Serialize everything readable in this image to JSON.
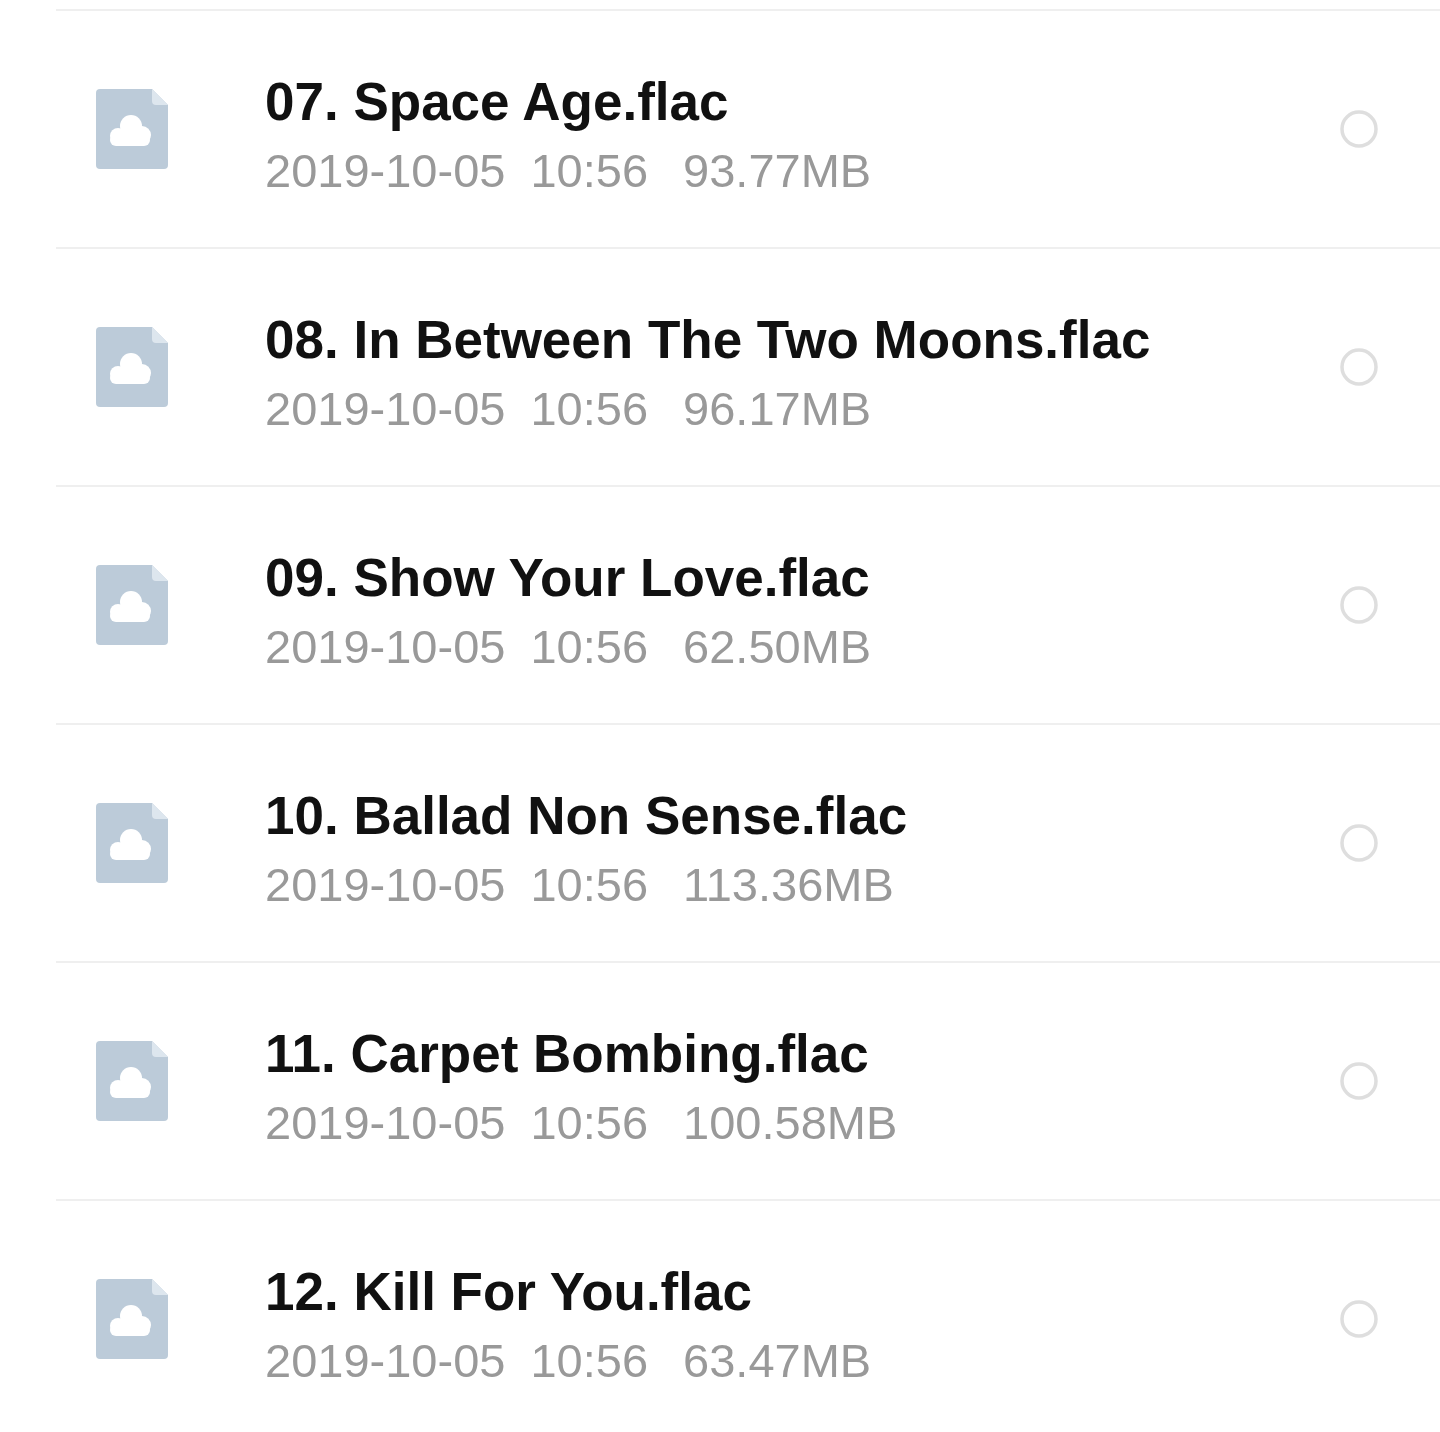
{
  "files": [
    {
      "name": "07. Space Age.flac",
      "date": "2019-10-05",
      "time": "10:56",
      "size": "93.77MB",
      "selected": false
    },
    {
      "name": "08. In Between The Two Moons.flac",
      "date": "2019-10-05",
      "time": "10:56",
      "size": "96.17MB",
      "selected": false
    },
    {
      "name": "09. Show Your Love.flac",
      "date": "2019-10-05",
      "time": "10:56",
      "size": "62.50MB",
      "selected": false
    },
    {
      "name": "10. Ballad Non Sense.flac",
      "date": "2019-10-05",
      "time": "10:56",
      "size": "113.36MB",
      "selected": false
    },
    {
      "name": "11. Carpet Bombing.flac",
      "date": "2019-10-05",
      "time": "10:56",
      "size": "100.58MB",
      "selected": false
    },
    {
      "name": "12. Kill For You.flac",
      "date": "2019-10-05",
      "time": "10:56",
      "size": "63.47MB",
      "selected": false
    }
  ]
}
